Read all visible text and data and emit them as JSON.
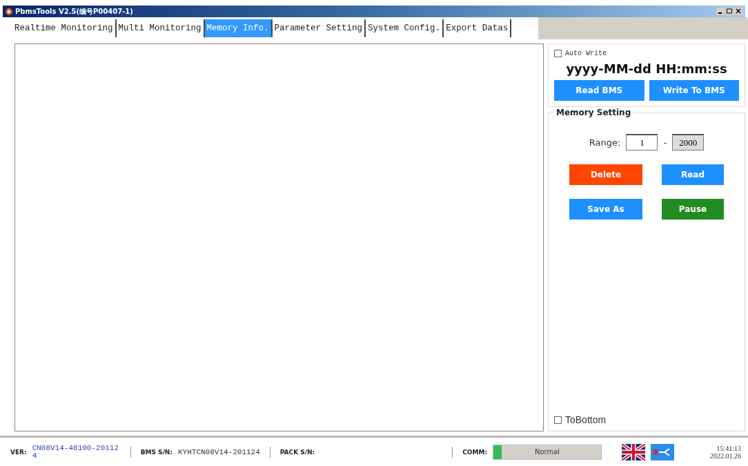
{
  "window": {
    "title": "PbmsTools V2.5(编号P00407-1)"
  },
  "tabs": [
    {
      "label": "Realtime Monitoring",
      "selected": false
    },
    {
      "label": "Multi Monitoring",
      "selected": false
    },
    {
      "label": "Memory Info.",
      "selected": true
    },
    {
      "label": "Parameter Setting",
      "selected": false
    },
    {
      "label": "System Config.",
      "selected": false
    },
    {
      "label": "Export Datas",
      "selected": false
    }
  ],
  "write_panel": {
    "auto_write": {
      "label": "Auto Write",
      "checked": false
    },
    "datetime_format": "yyyy-MM-dd HH:mm:ss",
    "buttons": [
      {
        "label": "Read BMS"
      },
      {
        "label": "Write To BMS"
      }
    ]
  },
  "memory_setting": {
    "title": "Memory Setting",
    "range_label": "Range:",
    "range_from": "1",
    "range_separator": "-",
    "range_to": "2000",
    "buttons": [
      {
        "label": "Delete",
        "color": "#ff4500"
      },
      {
        "label": "Read",
        "color": "#1e90ff"
      },
      {
        "label": "Save As",
        "color": "#1e90ff"
      },
      {
        "label": "Pause",
        "color": "#228b22"
      }
    ],
    "to_bottom": {
      "label": "ToBottom",
      "checked": false
    }
  },
  "status_bar": {
    "ver_label": "VER:",
    "ver": "CN08V14-48100-201124",
    "bms_sn_label": "BMS S/N:",
    "bms_sn": "KYHTCN08V14-201124",
    "pack_sn_label": "PACK S/N:",
    "comm": {
      "label": "COMM:",
      "status": "Normal",
      "level": 0.08
    },
    "time": "15:41:13",
    "date": "2022.01.26"
  }
}
